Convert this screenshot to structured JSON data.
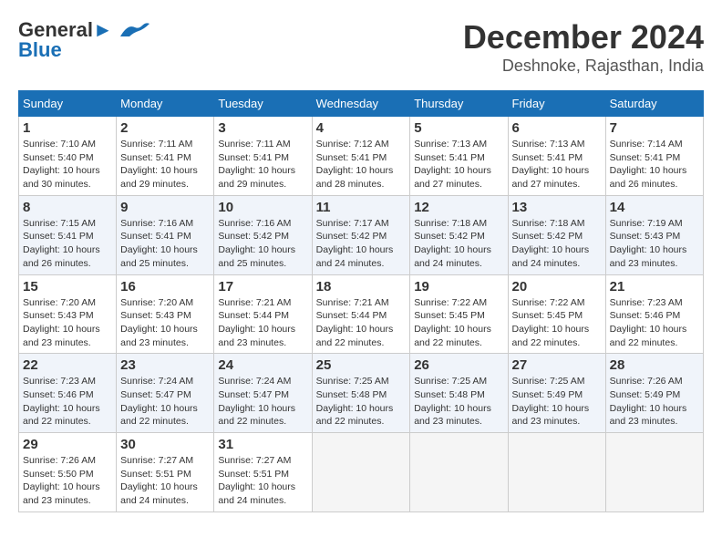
{
  "app": {
    "logo_line1": "General",
    "logo_line2": "Blue"
  },
  "header": {
    "title": "December 2024",
    "subtitle": "Deshnoke, Rajasthan, India"
  },
  "calendar": {
    "days_of_week": [
      "Sunday",
      "Monday",
      "Tuesday",
      "Wednesday",
      "Thursday",
      "Friday",
      "Saturday"
    ],
    "weeks": [
      [
        null,
        {
          "day": 2,
          "sunrise": "7:11 AM",
          "sunset": "5:41 PM",
          "daylight": "10 hours and 29 minutes."
        },
        {
          "day": 3,
          "sunrise": "7:11 AM",
          "sunset": "5:41 PM",
          "daylight": "10 hours and 29 minutes."
        },
        {
          "day": 4,
          "sunrise": "7:12 AM",
          "sunset": "5:41 PM",
          "daylight": "10 hours and 28 minutes."
        },
        {
          "day": 5,
          "sunrise": "7:13 AM",
          "sunset": "5:41 PM",
          "daylight": "10 hours and 27 minutes."
        },
        {
          "day": 6,
          "sunrise": "7:13 AM",
          "sunset": "5:41 PM",
          "daylight": "10 hours and 27 minutes."
        },
        {
          "day": 7,
          "sunrise": "7:14 AM",
          "sunset": "5:41 PM",
          "daylight": "10 hours and 26 minutes."
        }
      ],
      [
        {
          "day": 1,
          "sunrise": "7:10 AM",
          "sunset": "5:40 PM",
          "daylight": "10 hours and 30 minutes."
        },
        null,
        null,
        null,
        null,
        null,
        null
      ],
      [
        {
          "day": 8,
          "sunrise": "7:15 AM",
          "sunset": "5:41 PM",
          "daylight": "10 hours and 26 minutes."
        },
        {
          "day": 9,
          "sunrise": "7:16 AM",
          "sunset": "5:41 PM",
          "daylight": "10 hours and 25 minutes."
        },
        {
          "day": 10,
          "sunrise": "7:16 AM",
          "sunset": "5:42 PM",
          "daylight": "10 hours and 25 minutes."
        },
        {
          "day": 11,
          "sunrise": "7:17 AM",
          "sunset": "5:42 PM",
          "daylight": "10 hours and 24 minutes."
        },
        {
          "day": 12,
          "sunrise": "7:18 AM",
          "sunset": "5:42 PM",
          "daylight": "10 hours and 24 minutes."
        },
        {
          "day": 13,
          "sunrise": "7:18 AM",
          "sunset": "5:42 PM",
          "daylight": "10 hours and 24 minutes."
        },
        {
          "day": 14,
          "sunrise": "7:19 AM",
          "sunset": "5:43 PM",
          "daylight": "10 hours and 23 minutes."
        }
      ],
      [
        {
          "day": 15,
          "sunrise": "7:20 AM",
          "sunset": "5:43 PM",
          "daylight": "10 hours and 23 minutes."
        },
        {
          "day": 16,
          "sunrise": "7:20 AM",
          "sunset": "5:43 PM",
          "daylight": "10 hours and 23 minutes."
        },
        {
          "day": 17,
          "sunrise": "7:21 AM",
          "sunset": "5:44 PM",
          "daylight": "10 hours and 23 minutes."
        },
        {
          "day": 18,
          "sunrise": "7:21 AM",
          "sunset": "5:44 PM",
          "daylight": "10 hours and 22 minutes."
        },
        {
          "day": 19,
          "sunrise": "7:22 AM",
          "sunset": "5:45 PM",
          "daylight": "10 hours and 22 minutes."
        },
        {
          "day": 20,
          "sunrise": "7:22 AM",
          "sunset": "5:45 PM",
          "daylight": "10 hours and 22 minutes."
        },
        {
          "day": 21,
          "sunrise": "7:23 AM",
          "sunset": "5:46 PM",
          "daylight": "10 hours and 22 minutes."
        }
      ],
      [
        {
          "day": 22,
          "sunrise": "7:23 AM",
          "sunset": "5:46 PM",
          "daylight": "10 hours and 22 minutes."
        },
        {
          "day": 23,
          "sunrise": "7:24 AM",
          "sunset": "5:47 PM",
          "daylight": "10 hours and 22 minutes."
        },
        {
          "day": 24,
          "sunrise": "7:24 AM",
          "sunset": "5:47 PM",
          "daylight": "10 hours and 22 minutes."
        },
        {
          "day": 25,
          "sunrise": "7:25 AM",
          "sunset": "5:48 PM",
          "daylight": "10 hours and 22 minutes."
        },
        {
          "day": 26,
          "sunrise": "7:25 AM",
          "sunset": "5:48 PM",
          "daylight": "10 hours and 23 minutes."
        },
        {
          "day": 27,
          "sunrise": "7:25 AM",
          "sunset": "5:49 PM",
          "daylight": "10 hours and 23 minutes."
        },
        {
          "day": 28,
          "sunrise": "7:26 AM",
          "sunset": "5:49 PM",
          "daylight": "10 hours and 23 minutes."
        }
      ],
      [
        {
          "day": 29,
          "sunrise": "7:26 AM",
          "sunset": "5:50 PM",
          "daylight": "10 hours and 23 minutes."
        },
        {
          "day": 30,
          "sunrise": "7:27 AM",
          "sunset": "5:51 PM",
          "daylight": "10 hours and 24 minutes."
        },
        {
          "day": 31,
          "sunrise": "7:27 AM",
          "sunset": "5:51 PM",
          "daylight": "10 hours and 24 minutes."
        },
        null,
        null,
        null,
        null
      ]
    ]
  }
}
